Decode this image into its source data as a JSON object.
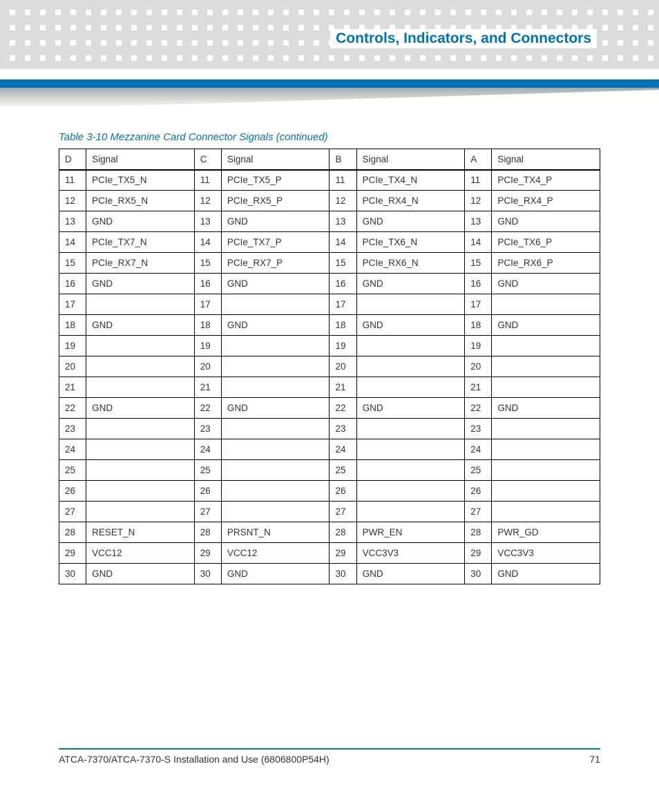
{
  "header": {
    "section_title": "Controls, Indicators, and Connectors"
  },
  "table": {
    "caption": "Table 3-10 Mezzanine Card Connector Signals  (continued)",
    "columns": [
      "D",
      "Signal",
      "C",
      "Signal",
      "B",
      "Signal",
      "A",
      "Signal"
    ],
    "rows": [
      [
        "11",
        "PCIe_TX5_N",
        "11",
        "PCIe_TX5_P",
        "11",
        "PCIe_TX4_N",
        "11",
        "PCIe_TX4_P"
      ],
      [
        "12",
        "PCIe_RX5_N",
        "12",
        "PCIe_RX5_P",
        "12",
        "PCIe_RX4_N",
        "12",
        "PCIe_RX4_P"
      ],
      [
        "13",
        "GND",
        "13",
        "GND",
        "13",
        "GND",
        "13",
        "GND"
      ],
      [
        "14",
        "PCIe_TX7_N",
        "14",
        "PCIe_TX7_P",
        "14",
        "PCIe_TX6_N",
        "14",
        "PCIe_TX6_P"
      ],
      [
        "15",
        "PCIe_RX7_N",
        "15",
        "PCIe_RX7_P",
        "15",
        "PCIe_RX6_N",
        "15",
        "PCIe_RX6_P"
      ],
      [
        "16",
        "GND",
        "16",
        "GND",
        "16",
        "GND",
        "16",
        "GND"
      ],
      [
        "17",
        "",
        "17",
        "",
        "17",
        "",
        "17",
        ""
      ],
      [
        "18",
        "GND",
        "18",
        "GND",
        "18",
        "GND",
        "18",
        "GND"
      ],
      [
        "19",
        "",
        "19",
        "",
        "19",
        "",
        "19",
        ""
      ],
      [
        "20",
        "",
        "20",
        "",
        "20",
        "",
        "20",
        ""
      ],
      [
        "21",
        "",
        "21",
        "",
        "21",
        "",
        "21",
        ""
      ],
      [
        "22",
        "GND",
        "22",
        "GND",
        "22",
        "GND",
        "22",
        "GND"
      ],
      [
        "23",
        "",
        "23",
        "",
        "23",
        "",
        "23",
        ""
      ],
      [
        "24",
        "",
        "24",
        "",
        "24",
        "",
        "24",
        ""
      ],
      [
        "25",
        "",
        "25",
        "",
        "25",
        "",
        "25",
        ""
      ],
      [
        "26",
        "",
        "26",
        "",
        "26",
        "",
        "26",
        ""
      ],
      [
        "27",
        "",
        "27",
        "",
        "27",
        "",
        "27",
        ""
      ],
      [
        "28",
        "RESET_N",
        "28",
        "PRSNT_N",
        "28",
        "PWR_EN",
        "28",
        "PWR_GD"
      ],
      [
        "29",
        "VCC12",
        "29",
        "VCC12",
        "29",
        "VCC3V3",
        "29",
        "VCC3V3"
      ],
      [
        "30",
        "GND",
        "30",
        "GND",
        "30",
        "GND",
        "30",
        "GND"
      ]
    ]
  },
  "footer": {
    "doc_title": "ATCA-7370/ATCA-7370-S Installation and Use (6806800P54H)",
    "page_number": "71"
  }
}
